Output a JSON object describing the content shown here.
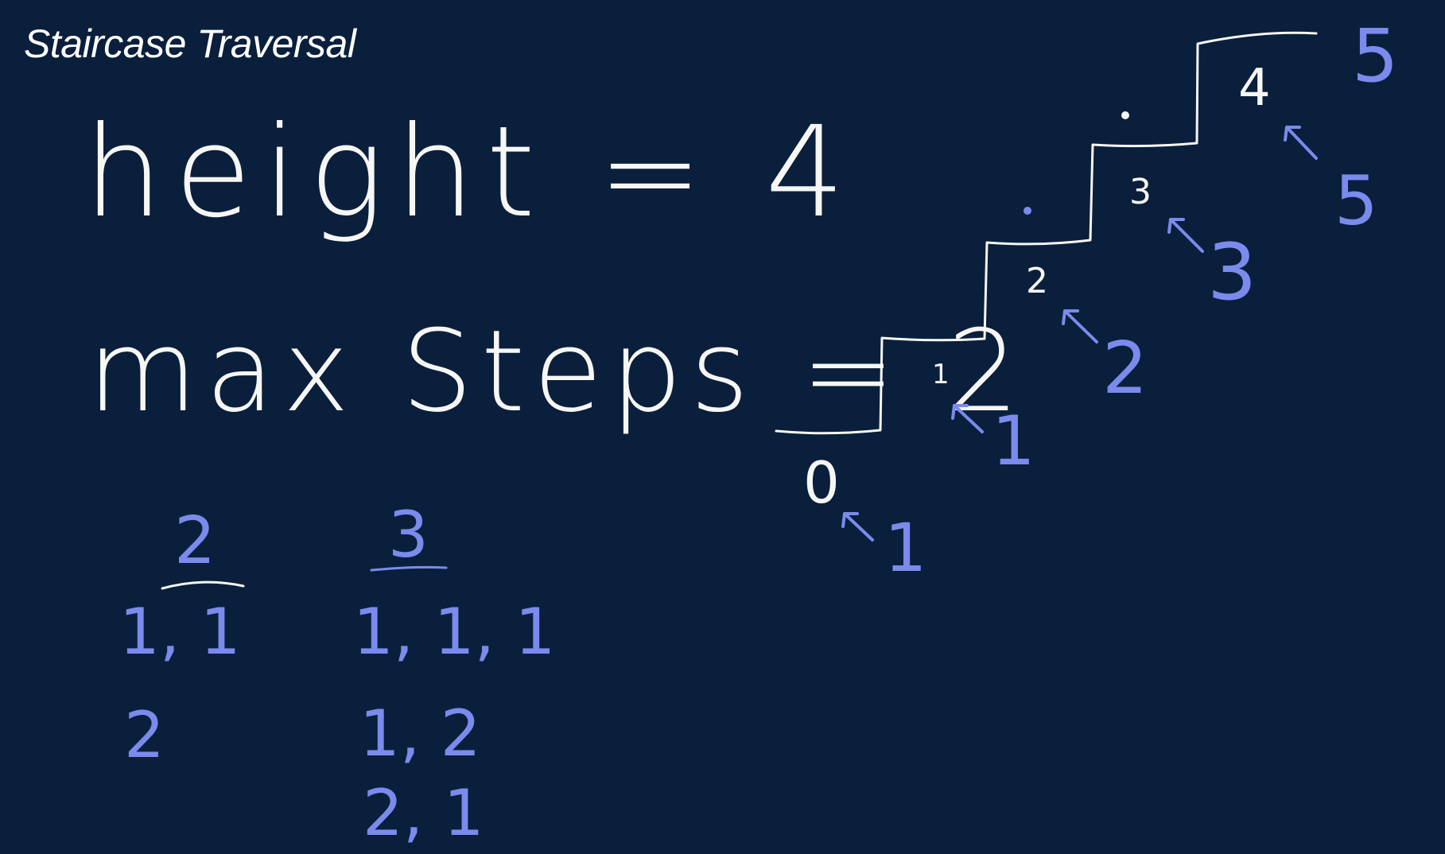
{
  "title": "Staircase Traversal",
  "equation_height": "height = 4",
  "equation_max_steps": "max Steps = 2",
  "colors": {
    "background": "#0a1f3b",
    "chalk_white": "#f6f6f4",
    "chalk_blue": "#7b8aec"
  },
  "staircase": {
    "step_labels": [
      "0",
      "1",
      "2",
      "3",
      "4"
    ],
    "ways_labels": [
      "1",
      "1",
      "2",
      "3",
      "5"
    ],
    "top_label": "5"
  },
  "ways_lists": [
    {
      "header": "2",
      "items": [
        "1, 1",
        "2"
      ]
    },
    {
      "header": "3",
      "items": [
        "1, 1, 1",
        "1, 2",
        "2, 1"
      ]
    }
  ]
}
